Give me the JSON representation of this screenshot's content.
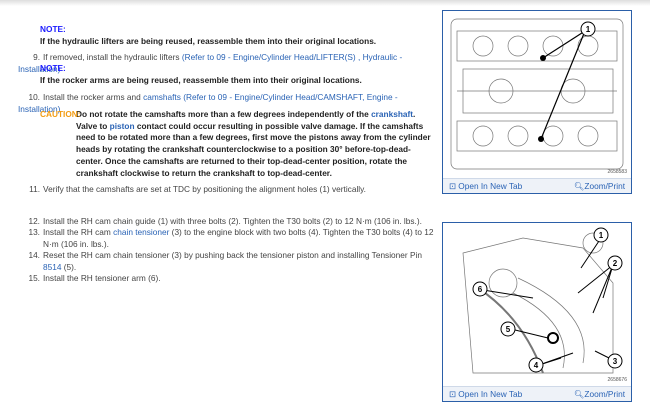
{
  "note1": {
    "label": "NOTE:",
    "text": "If the hydraulic lifters are being reused, reassemble them into their original locations."
  },
  "step9": {
    "num": "9.",
    "text": "If removed, install the hydraulic lifters ",
    "link": "(Refer to 09 - Engine/Cylinder Head/LIFTER(S) , Hydraulic - Installation)"
  },
  "note2": {
    "label": "NOTE:",
    "text": "If the rocker arms are being reused, reassemble them into their original locations."
  },
  "step10": {
    "num": "10.",
    "text": "Install the rocker arms and ",
    "link1": "camshafts",
    "link2": "(Refer to 09 - Engine/Cylinder Head/CAMSHAFT, Engine - Installation)"
  },
  "caution": {
    "label": "CAUTION:",
    "t1": "Do not rotate the camshafts more than a few degrees independently of the ",
    "link1": "crankshaft",
    "t2": ". Valve to ",
    "link2": "piston",
    "t3": " contact could occur resulting in possible valve damage. If the camshafts need to be rotated more than a few degrees, first move the pistons away from the cylinder heads by rotating the crankshaft counterclockwise to a position 30° before-top-dead-center. Once the camshafts are returned to their top-dead-center position, rotate the crankshaft clockwise to return the crankshaft to top-dead-center."
  },
  "step11": {
    "num": "11.",
    "text": "Verify that the camshafts are set at TDC by positioning the alignment holes (1) vertically."
  },
  "step12": {
    "num": "12.",
    "text": "Install the RH cam chain guide (1) with three bolts (2). Tighten the T30 bolts (2) to 12 N·m (106 in. lbs.)."
  },
  "step13": {
    "num": "13.",
    "t1": "Install the RH cam ",
    "link": "chain tensioner",
    "t2": " (3) to the engine block with two bolts (4). Tighten the T30 bolts (4) to 12 N·m (106 in. lbs.)."
  },
  "step14": {
    "num": "14.",
    "t1": "Reset the RH cam chain tensioner (3) by pushing back the tensioner piston and installing Tensioner Pin ",
    "link": "8514",
    "t2": " (5)."
  },
  "step15": {
    "num": "15.",
    "text": "Install the RH tensioner arm (6)."
  },
  "figure1": {
    "id": "2658583",
    "callouts": [
      "1"
    ],
    "open": "Open In New Tab",
    "zoom": "Zoom/Print"
  },
  "figure2": {
    "id": "2658676",
    "callouts": [
      "1",
      "2",
      "3",
      "4",
      "5",
      "6"
    ],
    "open": "Open In New Tab",
    "zoom": "Zoom/Print"
  },
  "colors": {
    "link": "#2a63b5",
    "note": "#1a1aff",
    "caution": "#f39c12",
    "figure_border": "#2b5fa8"
  }
}
